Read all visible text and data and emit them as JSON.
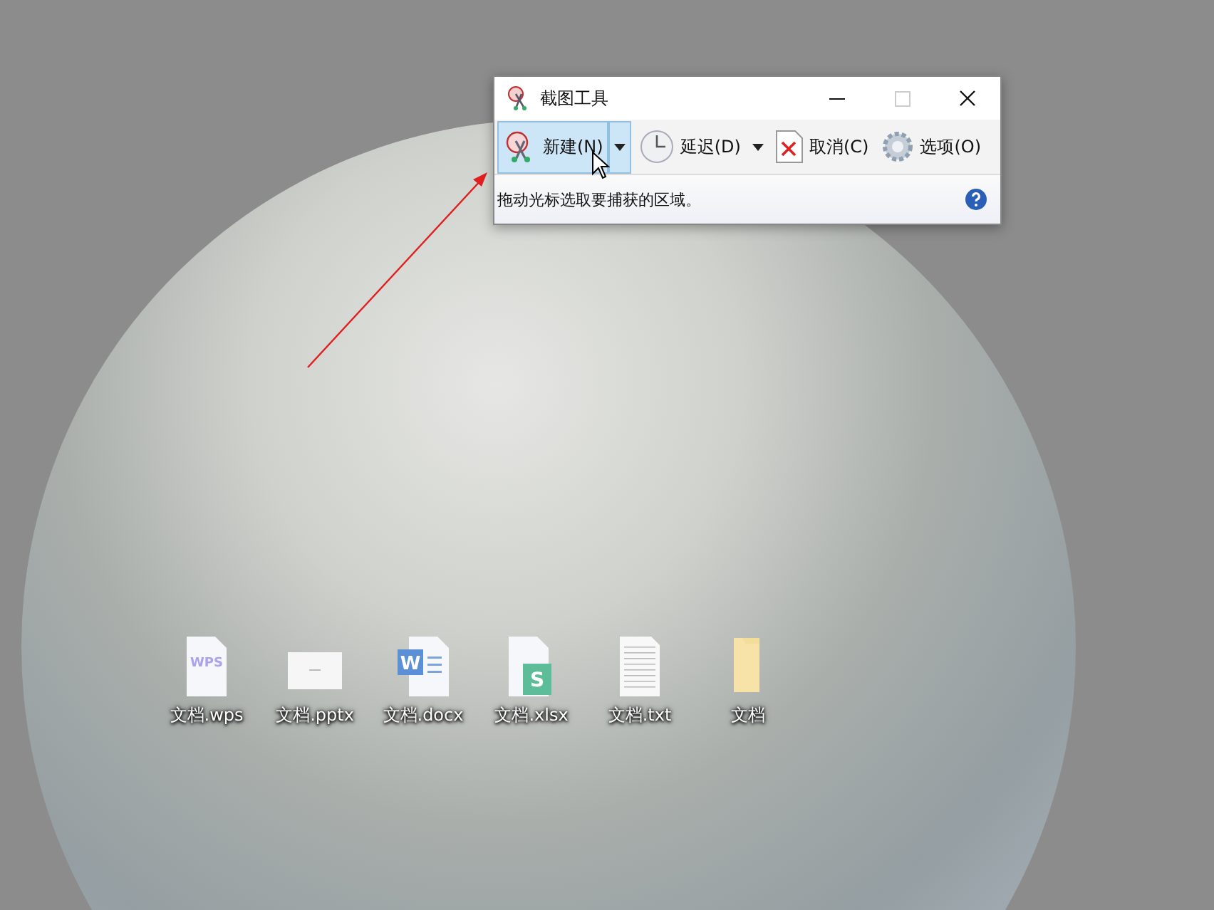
{
  "window": {
    "title": "截图工具",
    "maximize_disabled": true
  },
  "toolbar": [
    {
      "kind": "split",
      "label": "新建(N)",
      "selected": true
    },
    {
      "kind": "dropdown",
      "label": "延迟(D)",
      "selected": false
    },
    {
      "kind": "button",
      "label": "取消(C)",
      "selected": false
    },
    {
      "kind": "button",
      "label": "选项(O)",
      "selected": false
    }
  ],
  "status_text": "拖动光标选取要捕获的区域。",
  "desktop_icons": [
    {
      "kind": "wps",
      "badge": "WPS",
      "label": "文档.wps"
    },
    {
      "kind": "pptx",
      "label": "文档.pptx"
    },
    {
      "kind": "docx",
      "badge": "W",
      "label": "文档.docx"
    },
    {
      "kind": "xlsx",
      "badge": "S",
      "label": "文档.xlsx"
    },
    {
      "kind": "txt",
      "label": "文档.txt"
    },
    {
      "kind": "folder",
      "label": "文档"
    }
  ]
}
